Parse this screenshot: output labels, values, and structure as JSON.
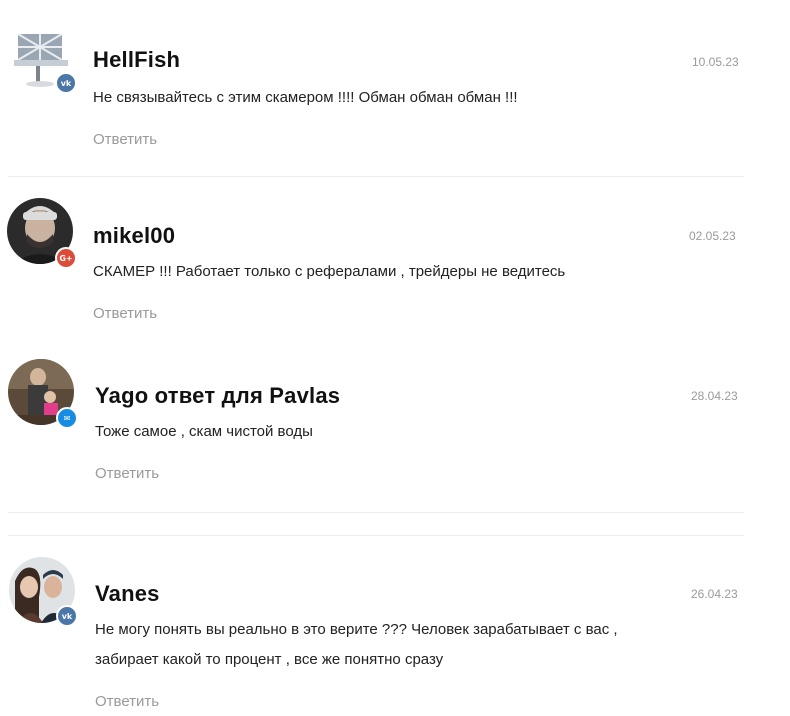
{
  "reply_label": "Ответить",
  "colors": {
    "vk": "#4a76a8",
    "google": "#dd4b39",
    "mail": "#168de2"
  },
  "comments": [
    {
      "author": "HellFish",
      "date": "10.05.23",
      "text": [
        "Не связывайтесь с этим скамером !!!! Обман обман обман !!!"
      ],
      "badge": {
        "icon": "vk-icon",
        "glyph": "vk"
      }
    },
    {
      "author": "mikel00",
      "date": "02.05.23",
      "text": [
        "СКАМЕР !!! Работает только с рефералами , трейдеры не ведитесь"
      ],
      "badge": {
        "icon": "google-plus-icon",
        "glyph": "G+"
      }
    },
    {
      "author": "Yago ответ для Pavlas",
      "date": "28.04.23",
      "text": [
        "Тоже самое , скам чистой воды"
      ],
      "badge": {
        "icon": "mail-icon",
        "glyph": "✉"
      }
    },
    {
      "author": "Vanes",
      "date": "26.04.23",
      "text": [
        "Не могу понять вы реально в это верите ??? Человек зарабатывает с вас ,",
        "забирает какой то процент , все же понятно сразу"
      ],
      "badge": {
        "icon": "vk-icon",
        "glyph": "vk"
      }
    }
  ]
}
